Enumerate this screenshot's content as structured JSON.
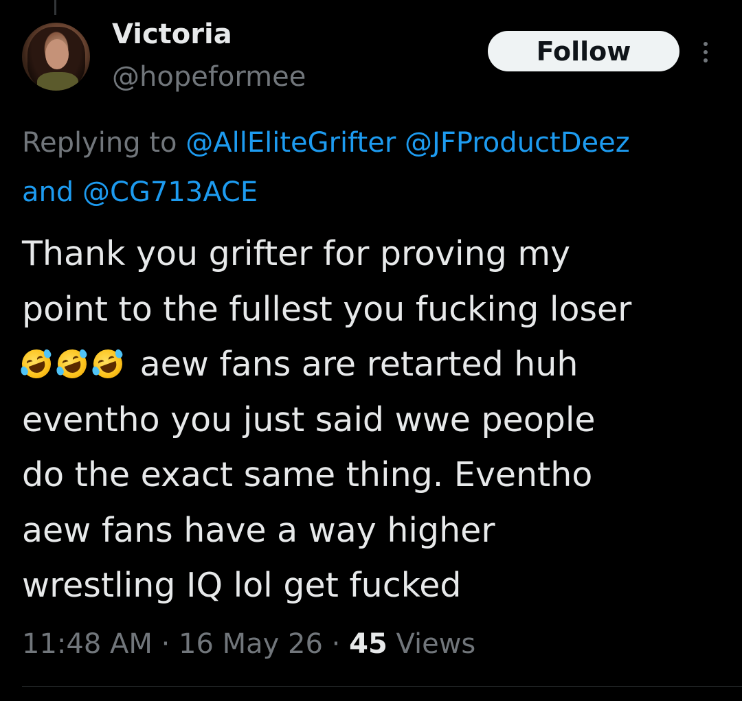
{
  "author": {
    "display_name": "Victoria",
    "handle": "@hopeformee"
  },
  "actions": {
    "follow_label": "Follow"
  },
  "reply_context": {
    "prefix": "Replying to",
    "mentions": [
      "@AllEliteGrifter",
      "@JFProductDeez"
    ],
    "conjunction": "and",
    "last_mention": "@CG713ACE"
  },
  "tweet": {
    "lines": [
      "Thank you grifter for proving my",
      "point to the fullest you fucking loser",
      "aew fans are retarted huh",
      "eventho you just said wwe people",
      "do the exact same thing. Eventho",
      "aew fans have a way higher",
      "wrestling IQ lol get fucked"
    ],
    "emoji": "rolling-on-the-floor-laughing",
    "emoji_count": 3
  },
  "meta": {
    "time": "11:48 AM",
    "separator": "·",
    "date": "16 May 26",
    "views_count": "45",
    "views_label": "Views"
  },
  "colors": {
    "background": "#000000",
    "text": "#e7e9ea",
    "secondary": "#71767b",
    "link": "#1d9bf0",
    "follow_bg": "#eff3f4"
  }
}
